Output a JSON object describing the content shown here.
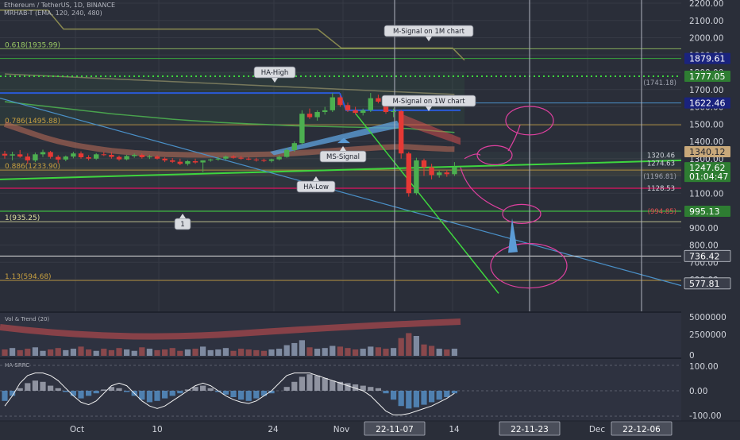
{
  "header": {
    "symbol_line": "Ethereum / TetherUS, 1D, BINANCE",
    "indicator_line": "MRHAB-T (EMA, 120, 240, 480)"
  },
  "colors": {
    "background": "#2a2e39",
    "grid": "#363a45",
    "axis_text": "#d1d4dc",
    "candle_up": "#4caf50",
    "candle_down": "#e53935",
    "trendline_green": "#3ed53e",
    "trendline_blue": "#4a90c8",
    "circle_pink": "#e040a0",
    "fib_orange": "#c8a040",
    "vline": "#b0b4c0"
  },
  "chart_data": [
    {
      "type": "line",
      "panel": "price",
      "title": "Ethereum / TetherUS, 1D, BINANCE",
      "y_axis": {
        "ticks": [
          "2200.00",
          "2100.00",
          "2000.00",
          "1900.00",
          "1800.00",
          "1700.00",
          "1600.00",
          "1500.00",
          "1400.00",
          "1300.00",
          "1200.00",
          "1100.00",
          "1000.00",
          "900.00",
          "800.00",
          "700.00",
          "600.00"
        ],
        "range": [
          510,
          2220
        ],
        "scale": "linear",
        "side": "right"
      },
      "x_axis": {
        "ticks": [
          "Oct",
          "10",
          "24",
          "Nov",
          "14",
          "Dec"
        ],
        "highlighted": [
          "22-11-07",
          "22-11-23",
          "22-12-06"
        ]
      },
      "price_labels": [
        {
          "value": "1879.61",
          "style": "box",
          "color": "#1a237e"
        },
        {
          "value": "1777.05",
          "style": "box",
          "color": "#2e7d32"
        },
        {
          "value": "1622.46",
          "style": "box",
          "color": "#1a237e"
        },
        {
          "value": "1340.12",
          "style": "box",
          "color": "#c8a87a"
        },
        {
          "value": "1247.62",
          "style": "box",
          "color": "#2e7d32"
        },
        {
          "value": "01:04:47",
          "style": "box",
          "color": "#2e7d32"
        },
        {
          "value": "995.13",
          "style": "box",
          "color": "#2e7d32"
        },
        {
          "value": "736.42",
          "style": "box",
          "color": "#3a3e4a"
        },
        {
          "value": "577.81",
          "style": "box",
          "color": "#3a3e4a"
        },
        {
          "value": "1320.46",
          "style": "text",
          "color": "#d1d4dc"
        },
        {
          "value": "1274.63",
          "style": "text",
          "color": "#d1d4dc"
        },
        {
          "value": "1128.53",
          "style": "text",
          "color": "#d1d4dc"
        },
        {
          "value": "(1196.81)",
          "style": "text",
          "color": "#a0a4b0"
        },
        {
          "value": "(1741.18)",
          "style": "text",
          "color": "#a0a4b0"
        },
        {
          "value": "(994.85)",
          "style": "text",
          "color": "#e05050"
        }
      ],
      "fib_levels": [
        {
          "label": "0.618(1935.99)",
          "value": 1935.99
        },
        {
          "label": "0.786(1495.88)",
          "value": 1495.88
        },
        {
          "label": "0.886(1233.90)",
          "value": 1233.9
        },
        {
          "label": "1(935.25)",
          "value": 935.25
        },
        {
          "label": "1.13(594.68)",
          "value": 594.68
        }
      ],
      "annotations": [
        "M-Signal on 1M chart",
        "HA-High",
        "M-Signal on 1W chart",
        "MS-Signal",
        "HA-Low",
        "1"
      ],
      "candles": [
        [
          1328,
          1345,
          1300,
          1318
        ],
        [
          1318,
          1340,
          1290,
          1325
        ],
        [
          1325,
          1350,
          1305,
          1312
        ],
        [
          1312,
          1330,
          1270,
          1290
        ],
        [
          1290,
          1335,
          1280,
          1325
        ],
        [
          1325,
          1352,
          1310,
          1338
        ],
        [
          1338,
          1345,
          1300,
          1310
        ],
        [
          1310,
          1320,
          1275,
          1295
        ],
        [
          1295,
          1318,
          1285,
          1312
        ],
        [
          1312,
          1340,
          1302,
          1330
        ],
        [
          1330,
          1342,
          1300,
          1308
        ],
        [
          1308,
          1320,
          1290,
          1300
        ],
        [
          1300,
          1332,
          1293,
          1325
        ],
        [
          1325,
          1340,
          1315,
          1322
        ],
        [
          1322,
          1338,
          1300,
          1310
        ],
        [
          1310,
          1318,
          1288,
          1296
        ],
        [
          1296,
          1322,
          1290,
          1315
        ],
        [
          1315,
          1330,
          1305,
          1322
        ],
        [
          1322,
          1330,
          1300,
          1308
        ],
        [
          1308,
          1322,
          1298,
          1312
        ],
        [
          1312,
          1320,
          1295,
          1300
        ],
        [
          1300,
          1308,
          1280,
          1290
        ],
        [
          1290,
          1303,
          1275,
          1282
        ],
        [
          1282,
          1300,
          1262,
          1270
        ],
        [
          1270,
          1292,
          1260,
          1285
        ],
        [
          1285,
          1300,
          1270,
          1278
        ],
        [
          1278,
          1290,
          1222,
          1290
        ],
        [
          1290,
          1300,
          1282,
          1295
        ],
        [
          1295,
          1310,
          1288,
          1300
        ],
        [
          1300,
          1318,
          1292,
          1312
        ],
        [
          1312,
          1320,
          1300,
          1305
        ],
        [
          1305,
          1315,
          1293,
          1300
        ],
        [
          1300,
          1310,
          1290,
          1295
        ],
        [
          1295,
          1305,
          1283,
          1292
        ],
        [
          1292,
          1300,
          1280,
          1287
        ],
        [
          1287,
          1300,
          1278,
          1296
        ],
        [
          1296,
          1318,
          1290,
          1310
        ],
        [
          1310,
          1360,
          1305,
          1350
        ],
        [
          1350,
          1400,
          1340,
          1390
        ],
        [
          1390,
          1580,
          1380,
          1560
        ],
        [
          1560,
          1590,
          1530,
          1540
        ],
        [
          1540,
          1580,
          1520,
          1570
        ],
        [
          1570,
          1600,
          1555,
          1580
        ],
        [
          1580,
          1680,
          1570,
          1655
        ],
        [
          1655,
          1665,
          1600,
          1610
        ],
        [
          1610,
          1625,
          1570,
          1580
        ],
        [
          1580,
          1600,
          1555,
          1565
        ],
        [
          1565,
          1590,
          1550,
          1580
        ],
        [
          1580,
          1680,
          1570,
          1650
        ],
        [
          1650,
          1670,
          1620,
          1630
        ],
        [
          1630,
          1640,
          1560,
          1570
        ],
        [
          1570,
          1590,
          1540,
          1575
        ],
        [
          1575,
          1582,
          1300,
          1330
        ],
        [
          1330,
          1340,
          1080,
          1100
        ],
        [
          1100,
          1305,
          1090,
          1290
        ],
        [
          1290,
          1300,
          1200,
          1250
        ],
        [
          1250,
          1270,
          1180,
          1205
        ],
        [
          1205,
          1230,
          1190,
          1220
        ],
        [
          1220,
          1235,
          1195,
          1210
        ],
        [
          1210,
          1280,
          1200,
          1250
        ]
      ],
      "moving_averages": [
        {
          "name": "EMA 120",
          "color": "#c0705a",
          "values": [
            1500,
            1485,
            1470,
            1455,
            1440,
            1425,
            1412,
            1400,
            1390,
            1380,
            1372,
            1365,
            1358,
            1352,
            1346,
            1342,
            1338,
            1334,
            1331,
            1329,
            1327,
            1325,
            1324,
            1323,
            1322,
            1322,
            1321,
            1321,
            1321,
            1321,
            1321,
            1322,
            1323,
            1324,
            1325,
            1326,
            1327,
            1329,
            1331,
            1334,
            1337,
            1340,
            1343,
            1346,
            1349,
            1352,
            1355,
            1358,
            1361,
            1364,
            1366,
            1368,
            1369,
            1368,
            1365,
            1362,
            1360,
            1358,
            1356,
            1355
          ]
        },
        {
          "name": "EMA 240",
          "color": "#4caf50",
          "values": [
            1630,
            1625,
            1620,
            1615,
            1610,
            1605,
            1600,
            1595,
            1590,
            1585,
            1580,
            1575,
            1570,
            1565,
            1560,
            1556,
            1552,
            1548,
            1544,
            1540,
            1536,
            1532,
            1528,
            1525,
            1522,
            1519,
            1516,
            1513,
            1510,
            1508,
            1506,
            1504,
            1502,
            1500,
            1498,
            1496,
            1494,
            1492,
            1490,
            1489,
            1488,
            1487,
            1486,
            1485,
            1484,
            1483,
            1482,
            1481,
            1480,
            1479,
            1478,
            1477,
            1476,
            1474,
            1470,
            1466,
            1462,
            1458,
            1455,
            1452
          ]
        },
        {
          "name": "EMA 480",
          "color": "#808060",
          "values": [
            1790,
            1788,
            1786,
            1784,
            1782,
            1780,
            1778,
            1776,
            1774,
            1772,
            1770,
            1768,
            1766,
            1764,
            1762,
            1760,
            1758,
            1756,
            1754,
            1752,
            1750,
            1748,
            1746,
            1744,
            1742,
            1740,
            1738,
            1736,
            1734,
            1732,
            1730,
            1728,
            1726,
            1724,
            1722,
            1720,
            1718,
            1716,
            1714,
            1712,
            1710,
            1708,
            1706,
            1704,
            1702,
            1700,
            1698,
            1696,
            1694,
            1692,
            1690,
            1688,
            1686,
            1684,
            1682,
            1680,
            1678,
            1676,
            1674,
            1672
          ]
        }
      ]
    },
    {
      "type": "bar",
      "panel": "volume",
      "title": "Vol & Trend (20)",
      "y_axis": {
        "ticks": [
          "5000000",
          "2500000",
          "0"
        ],
        "range": [
          0,
          5600000
        ]
      },
      "values": [
        900000,
        1100000,
        800000,
        1000000,
        1200000,
        700000,
        900000,
        1100000,
        800000,
        1000000,
        1300000,
        900000,
        700000,
        1000000,
        800000,
        1100000,
        900000,
        700000,
        1200000,
        1000000,
        800000,
        900000,
        1100000,
        700000,
        900000,
        1000000,
        1300000,
        800000,
        900000,
        1100000,
        700000,
        1000000,
        900000,
        800000,
        700000,
        900000,
        1000000,
        1500000,
        1800000,
        2200000,
        1200000,
        1000000,
        1100000,
        1400000,
        1300000,
        1100000,
        900000,
        1000000,
        1300000,
        1200000,
        1000000,
        1100000,
        2500000,
        3200000,
        2800000,
        1600000,
        1400000,
        1000000,
        900000,
        1000000
      ]
    },
    {
      "type": "bar",
      "panel": "oscillator",
      "title": "HA-SRRC",
      "y_axis": {
        "ticks": [
          "100.00",
          "0.00",
          "-100.00"
        ],
        "range": [
          -125,
          125
        ]
      },
      "values": [
        -40,
        -20,
        10,
        30,
        40,
        35,
        20,
        10,
        -5,
        -20,
        -30,
        -20,
        -10,
        5,
        15,
        10,
        -5,
        -20,
        -35,
        -45,
        -40,
        -30,
        -20,
        -10,
        5,
        15,
        20,
        10,
        -5,
        -15,
        -25,
        -35,
        -40,
        -30,
        -20,
        -10,
        0,
        15,
        35,
        55,
        65,
        60,
        50,
        40,
        35,
        30,
        25,
        20,
        15,
        10,
        -10,
        -35,
        -60,
        -70,
        -65,
        -55,
        -45,
        -35,
        -25,
        -10
      ],
      "line_values": [
        -60,
        -20,
        30,
        60,
        70,
        70,
        60,
        40,
        10,
        -20,
        -45,
        -55,
        -40,
        -10,
        20,
        30,
        20,
        -10,
        -40,
        -60,
        -70,
        -60,
        -40,
        -20,
        0,
        20,
        30,
        20,
        0,
        -20,
        -35,
        -45,
        -50,
        -40,
        -20,
        0,
        30,
        60,
        70,
        70,
        70,
        60,
        50,
        40,
        30,
        20,
        10,
        0,
        -20,
        -50,
        -80,
        -95,
        -95,
        -90,
        -80,
        -70,
        -60,
        -45,
        -30,
        -10
      ]
    }
  ]
}
